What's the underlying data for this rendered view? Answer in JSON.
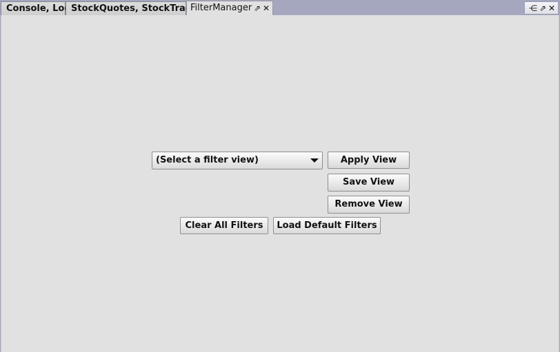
{
  "tabs": [
    {
      "label": "Console, Log"
    },
    {
      "label": "StockQuotes, StockTrades"
    },
    {
      "label": "FilterManager",
      "active": true
    }
  ],
  "tab_icons": {
    "float": "⇗",
    "close": "✕"
  },
  "corner_icons": {
    "menu": "⋲",
    "float": "⇗",
    "close": "✕"
  },
  "filter": {
    "select_value": "(Select a filter view)",
    "apply_label": "Apply View",
    "save_label": "Save View",
    "remove_label": "Remove View",
    "clear_label": "Clear All Filters",
    "load_label": "Load Default Filters"
  },
  "colors": {
    "tabbar": "#a4a7bd",
    "panel": "#e1e1e1"
  }
}
